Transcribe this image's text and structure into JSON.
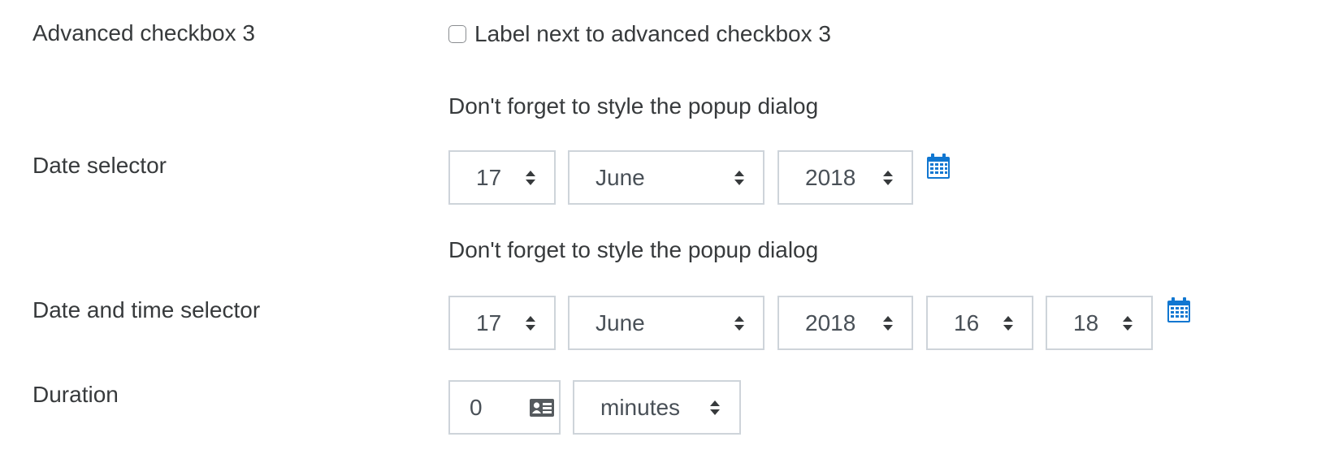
{
  "advanced_checkbox": {
    "label": "Advanced checkbox 3",
    "checkbox_label": "Label next to advanced checkbox 3",
    "checked": false
  },
  "date_selector": {
    "note": "Don't forget to style the popup dialog",
    "label": "Date selector",
    "day": "17",
    "month": "June",
    "year": "2018",
    "calendar_icon": "calendar-icon"
  },
  "datetime_selector": {
    "note": "Don't forget to style the popup dialog",
    "label": "Date and time selector",
    "day": "17",
    "month": "June",
    "year": "2018",
    "hour": "16",
    "minute": "18",
    "calendar_icon": "calendar-icon"
  },
  "duration": {
    "label": "Duration",
    "value": "0",
    "unit": "minutes",
    "input_icon": "id-card-icon"
  },
  "colors": {
    "text": "#373a3c",
    "border": "#ced4da",
    "accent": "#1177d1"
  }
}
